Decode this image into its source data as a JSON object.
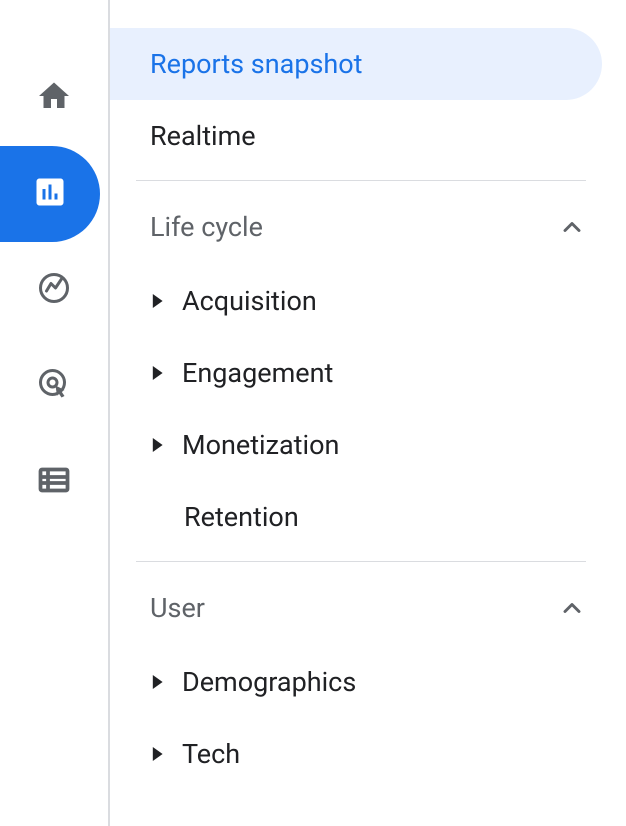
{
  "nav": {
    "reports_snapshot": "Reports snapshot",
    "realtime": "Realtime"
  },
  "sections": {
    "lifecycle": {
      "title": "Life cycle",
      "items": {
        "acquisition": "Acquisition",
        "engagement": "Engagement",
        "monetization": "Monetization",
        "retention": "Retention"
      }
    },
    "user": {
      "title": "User",
      "items": {
        "demographics": "Demographics",
        "tech": "Tech"
      }
    }
  }
}
